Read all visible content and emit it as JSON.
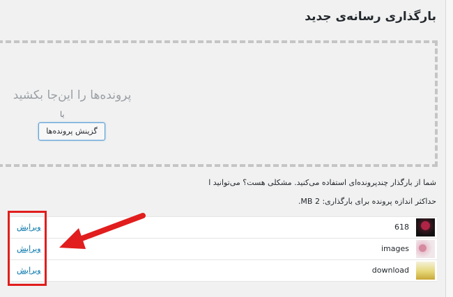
{
  "page": {
    "title": "بارگذاری رسانه‌ی جدید"
  },
  "dropzone": {
    "instructions": "پرونده‌ها را این‌جا بکشید",
    "or_text": "یا",
    "select_button": "گزینش پرونده‌ها"
  },
  "info": {
    "multi_uploader": "شما از بارگذار چندپرونده‌ای استفاده می‌کنید. مشکلی هست؟ می‌توانید ا",
    "max_size": "حداکثر اندازه پرونده برای بارگذاری: 2 MB."
  },
  "media_items": [
    {
      "filename": "618",
      "edit_label": "ویرایش"
    },
    {
      "filename": "images",
      "edit_label": "ویرایش"
    },
    {
      "filename": "download",
      "edit_label": "ویرایش"
    }
  ],
  "colors": {
    "highlight": "#e11d1d",
    "link": "#0073aa"
  }
}
